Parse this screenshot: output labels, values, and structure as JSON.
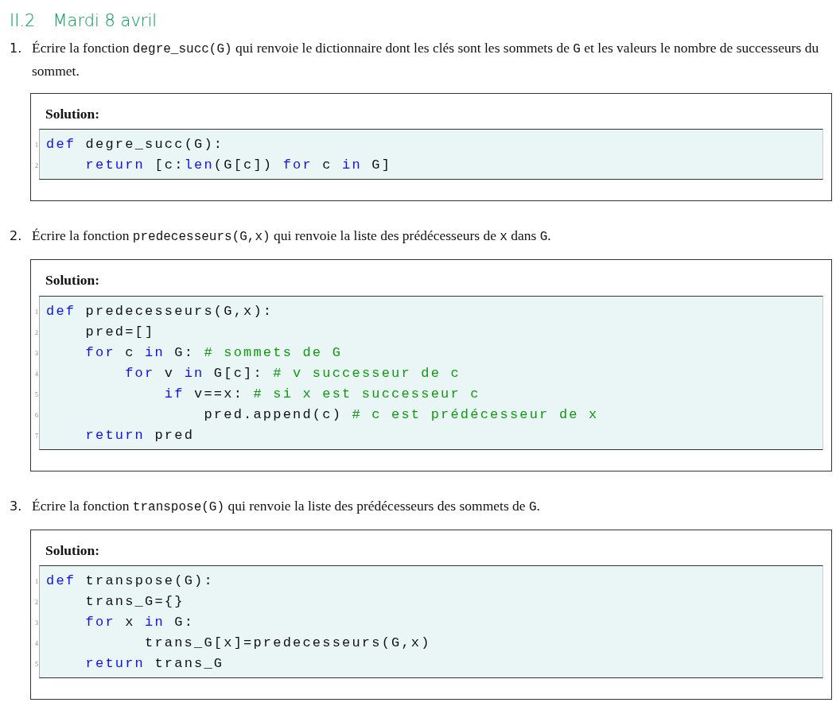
{
  "section": {
    "number": "II.2",
    "title": "Mardi 8 avril"
  },
  "questions": [
    {
      "number": "1.",
      "text": [
        {
          "kind": "text",
          "text": "Écrire la fonction "
        },
        {
          "kind": "code",
          "text": "degre_succ(G)"
        },
        {
          "kind": "text",
          "text": " qui renvoie le dictionnaire dont les clés sont les sommets de "
        },
        {
          "kind": "code",
          "text": "G"
        },
        {
          "kind": "text",
          "text": " et les valeurs le nombre de successeurs du sommet."
        }
      ],
      "solution": {
        "label": "Solution:",
        "lines": [
          {
            "number": "1",
            "tokens": [
              {
                "kind": "keyword",
                "text": "def"
              },
              {
                "kind": "plain",
                "text": " degre_succ(G):"
              }
            ]
          },
          {
            "number": "2",
            "tokens": [
              {
                "kind": "keyword",
                "text": "    return"
              },
              {
                "kind": "plain",
                "text": " [c:"
              },
              {
                "kind": "keyword",
                "text": "len"
              },
              {
                "kind": "plain",
                "text": "(G[c]) "
              },
              {
                "kind": "keyword",
                "text": "for"
              },
              {
                "kind": "plain",
                "text": " c "
              },
              {
                "kind": "keyword",
                "text": "in"
              },
              {
                "kind": "plain",
                "text": " G]"
              }
            ]
          }
        ]
      }
    },
    {
      "number": "2.",
      "text": [
        {
          "kind": "text",
          "text": "Écrire la fonction "
        },
        {
          "kind": "code",
          "text": "predecesseurs(G,x)"
        },
        {
          "kind": "text",
          "text": " qui renvoie la liste des prédécesseurs de "
        },
        {
          "kind": "code",
          "text": "x"
        },
        {
          "kind": "text",
          "text": " dans "
        },
        {
          "kind": "code",
          "text": "G"
        },
        {
          "kind": "text",
          "text": "."
        }
      ],
      "solution": {
        "label": "Solution:",
        "lines": [
          {
            "number": "1",
            "tokens": [
              {
                "kind": "keyword",
                "text": "def"
              },
              {
                "kind": "plain",
                "text": " predecesseurs(G,x):"
              }
            ]
          },
          {
            "number": "2",
            "tokens": [
              {
                "kind": "plain",
                "text": "    pred=[]"
              }
            ]
          },
          {
            "number": "3",
            "tokens": [
              {
                "kind": "keyword",
                "text": "    for"
              },
              {
                "kind": "plain",
                "text": " c "
              },
              {
                "kind": "keyword",
                "text": "in"
              },
              {
                "kind": "plain",
                "text": " G: "
              },
              {
                "kind": "comment",
                "text": "# sommets de G"
              }
            ]
          },
          {
            "number": "4",
            "tokens": [
              {
                "kind": "keyword",
                "text": "        for"
              },
              {
                "kind": "plain",
                "text": " v "
              },
              {
                "kind": "keyword",
                "text": "in"
              },
              {
                "kind": "plain",
                "text": " G[c]: "
              },
              {
                "kind": "comment",
                "text": "# v successeur de c"
              }
            ]
          },
          {
            "number": "5",
            "tokens": [
              {
                "kind": "keyword",
                "text": "            if"
              },
              {
                "kind": "plain",
                "text": " v==x: "
              },
              {
                "kind": "comment",
                "text": "# si x est successeur c"
              }
            ]
          },
          {
            "number": "6",
            "tokens": [
              {
                "kind": "plain",
                "text": "                pred.append(c) "
              },
              {
                "kind": "comment",
                "text": "# c est prédécesseur de x"
              }
            ]
          },
          {
            "number": "7",
            "tokens": [
              {
                "kind": "keyword",
                "text": "    return"
              },
              {
                "kind": "plain",
                "text": " pred"
              }
            ]
          }
        ]
      }
    },
    {
      "number": "3.",
      "text": [
        {
          "kind": "text",
          "text": "Écrire la fonction "
        },
        {
          "kind": "code",
          "text": "transpose(G)"
        },
        {
          "kind": "text",
          "text": " qui renvoie la liste des prédécesseurs des sommets de "
        },
        {
          "kind": "code",
          "text": "G"
        },
        {
          "kind": "text",
          "text": "."
        }
      ],
      "solution": {
        "label": "Solution:",
        "lines": [
          {
            "number": "1",
            "tokens": [
              {
                "kind": "keyword",
                "text": "def"
              },
              {
                "kind": "plain",
                "text": " transpose(G):"
              }
            ]
          },
          {
            "number": "2",
            "tokens": [
              {
                "kind": "plain",
                "text": "    trans_G={}"
              }
            ]
          },
          {
            "number": "3",
            "tokens": [
              {
                "kind": "keyword",
                "text": "    for"
              },
              {
                "kind": "plain",
                "text": " x "
              },
              {
                "kind": "keyword",
                "text": "in"
              },
              {
                "kind": "plain",
                "text": " G:"
              }
            ]
          },
          {
            "number": "4",
            "tokens": [
              {
                "kind": "plain",
                "text": "          trans_G[x]=predecesseurs(G,x)"
              }
            ]
          },
          {
            "number": "5",
            "tokens": [
              {
                "kind": "keyword",
                "text": "    return"
              },
              {
                "kind": "plain",
                "text": " trans_G"
              }
            ]
          }
        ]
      }
    }
  ]
}
